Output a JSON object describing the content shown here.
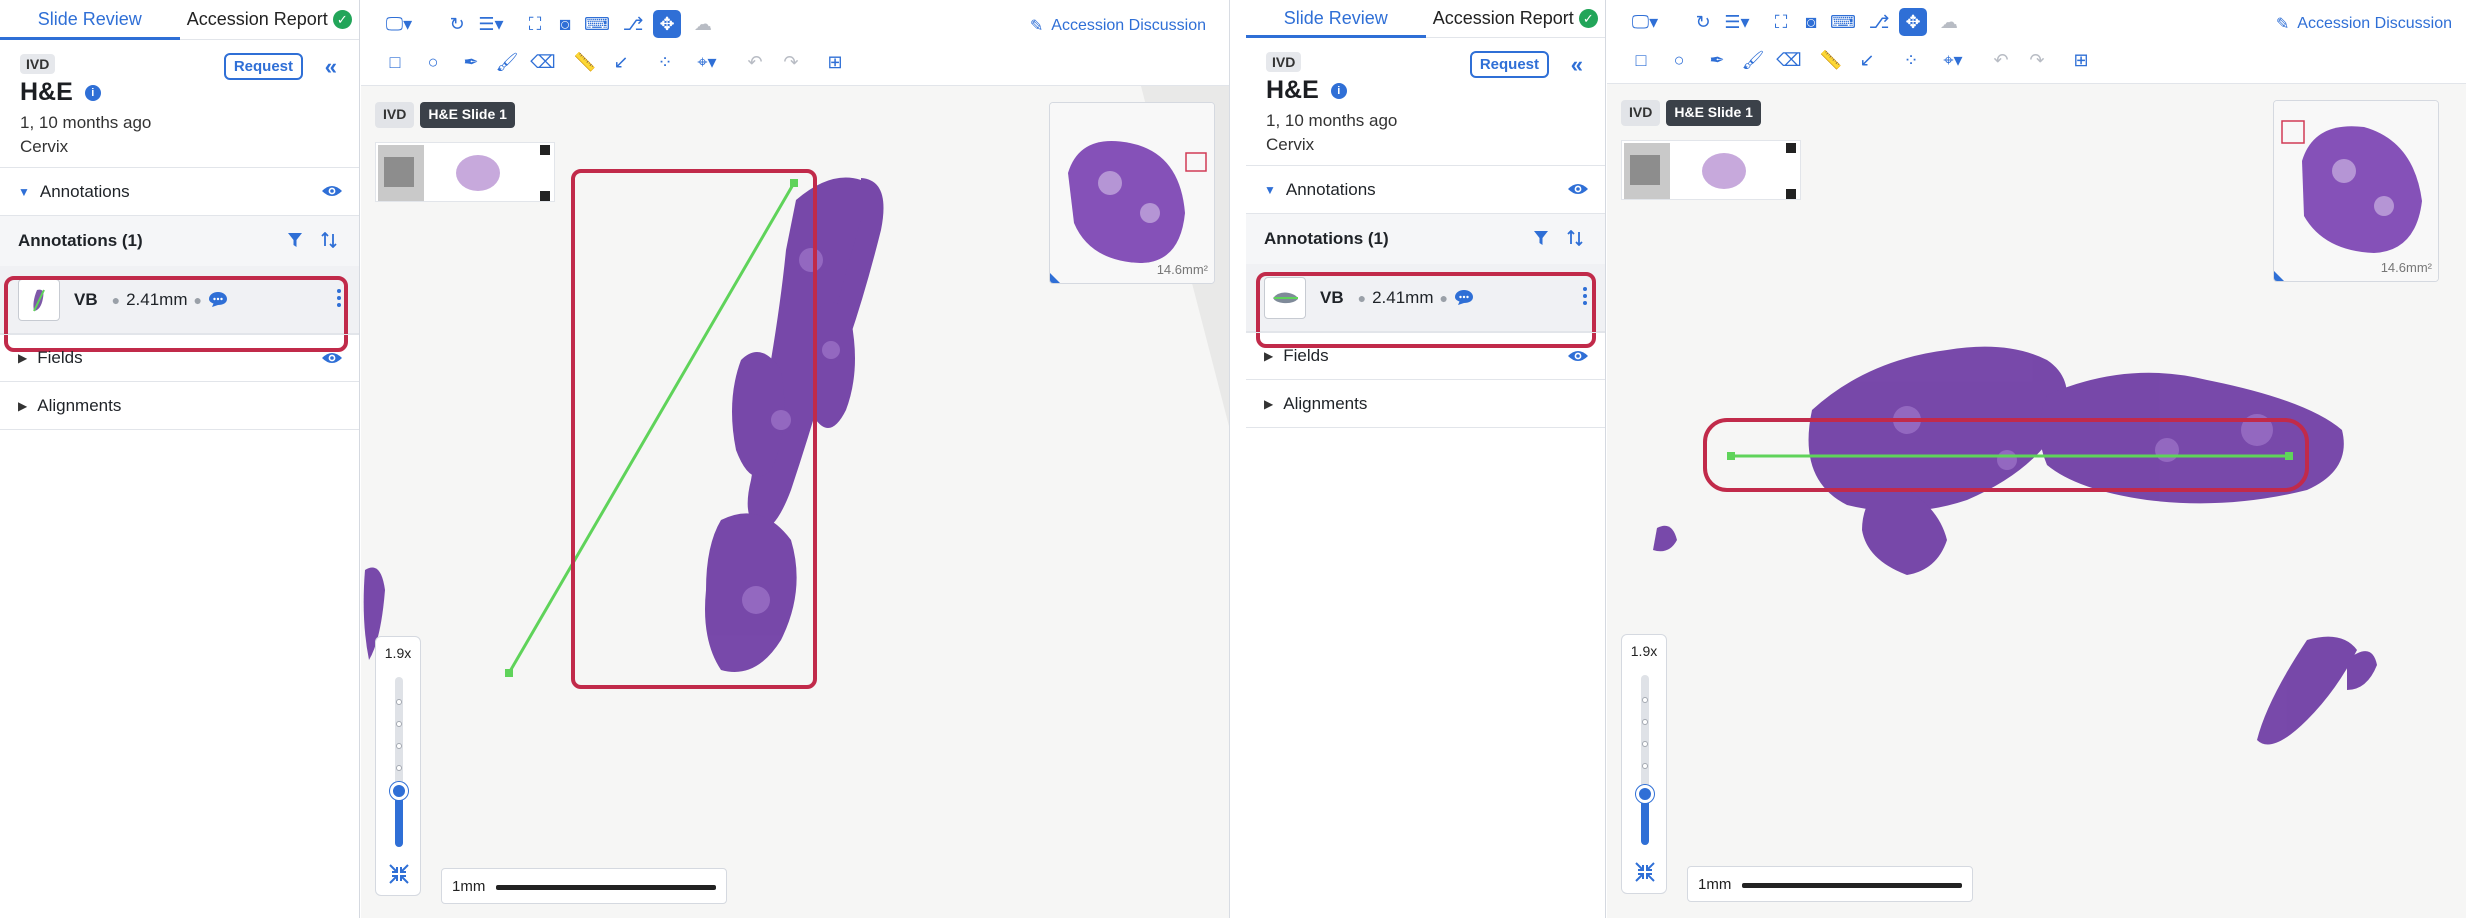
{
  "panels": [
    {
      "tabs": {
        "slide_review": "Slide Review",
        "accession_report": "Accession Report"
      },
      "badge": "IVD",
      "slide_title": "H&E",
      "meta": "1, 10 months ago",
      "tissue": "Cervix",
      "request_label": "Request",
      "annotations_section": "Annotations",
      "annotations_header": "Annotations (1)",
      "annotation": {
        "label": "VB",
        "measurement": "2.41mm"
      },
      "fields_section": "Fields",
      "alignments_section": "Alignments",
      "viewer": {
        "discussion_label": "Accession Discussion",
        "chip_badge": "IVD",
        "chip_slide": "H&E Slide 1",
        "minimap_area": "14.6mm²",
        "zoom_level": "1.9x",
        "zoom_fraction": 0.33,
        "scale_label": "1mm",
        "measurement_orientation": "diagonal"
      }
    },
    {
      "tabs": {
        "slide_review": "Slide Review",
        "accession_report": "Accession Report"
      },
      "badge": "IVD",
      "slide_title": "H&E",
      "meta": "1, 10 months ago",
      "tissue": "Cervix",
      "request_label": "Request",
      "annotations_section": "Annotations",
      "annotations_header": "Annotations (1)",
      "annotation": {
        "label": "VB",
        "measurement": "2.41mm"
      },
      "fields_section": "Fields",
      "alignments_section": "Alignments",
      "viewer": {
        "discussion_label": "Accession Discussion",
        "chip_badge": "IVD",
        "chip_slide": "H&E Slide 1",
        "minimap_area": "14.6mm²",
        "zoom_level": "1.9x",
        "zoom_fraction": 0.3,
        "scale_label": "1mm",
        "measurement_orientation": "horizontal"
      }
    }
  ],
  "colors": {
    "accent": "#2f6fd6",
    "highlight": "#c12a4a",
    "measure_line": "#5fd35a",
    "tissue": "#6d3aa3",
    "check": "#22a559"
  }
}
